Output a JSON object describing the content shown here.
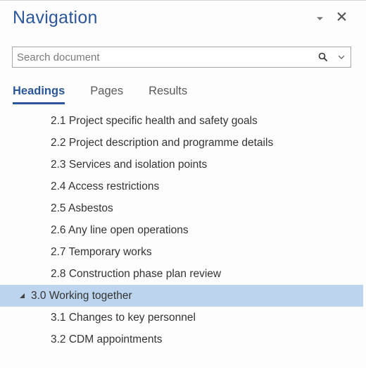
{
  "panel": {
    "title": "Navigation"
  },
  "search": {
    "placeholder": "Search document",
    "value": ""
  },
  "tabs": {
    "headings": "Headings",
    "pages": "Pages",
    "results": "Results",
    "active": "headings"
  },
  "tree": {
    "items": [
      {
        "label": "2.1 Project specific health and safety goals",
        "level": 2,
        "selected": false
      },
      {
        "label": "2.2 Project description and programme details",
        "level": 2,
        "selected": false
      },
      {
        "label": "2.3 Services and isolation points",
        "level": 2,
        "selected": false
      },
      {
        "label": "2.4 Access restrictions",
        "level": 2,
        "selected": false
      },
      {
        "label": "2.5 Asbestos",
        "level": 2,
        "selected": false
      },
      {
        "label": "2.6 Any line open operations",
        "level": 2,
        "selected": false
      },
      {
        "label": "2.7 Temporary works",
        "level": 2,
        "selected": false
      },
      {
        "label": "2.8 Construction phase plan review",
        "level": 2,
        "selected": false
      },
      {
        "label": "3.0 Working together",
        "level": 1,
        "selected": true,
        "expanded": true
      },
      {
        "label": "3.1 Changes to key personnel",
        "level": 2,
        "selected": false
      },
      {
        "label": "3.2 CDM appointments",
        "level": 2,
        "selected": false
      }
    ]
  }
}
